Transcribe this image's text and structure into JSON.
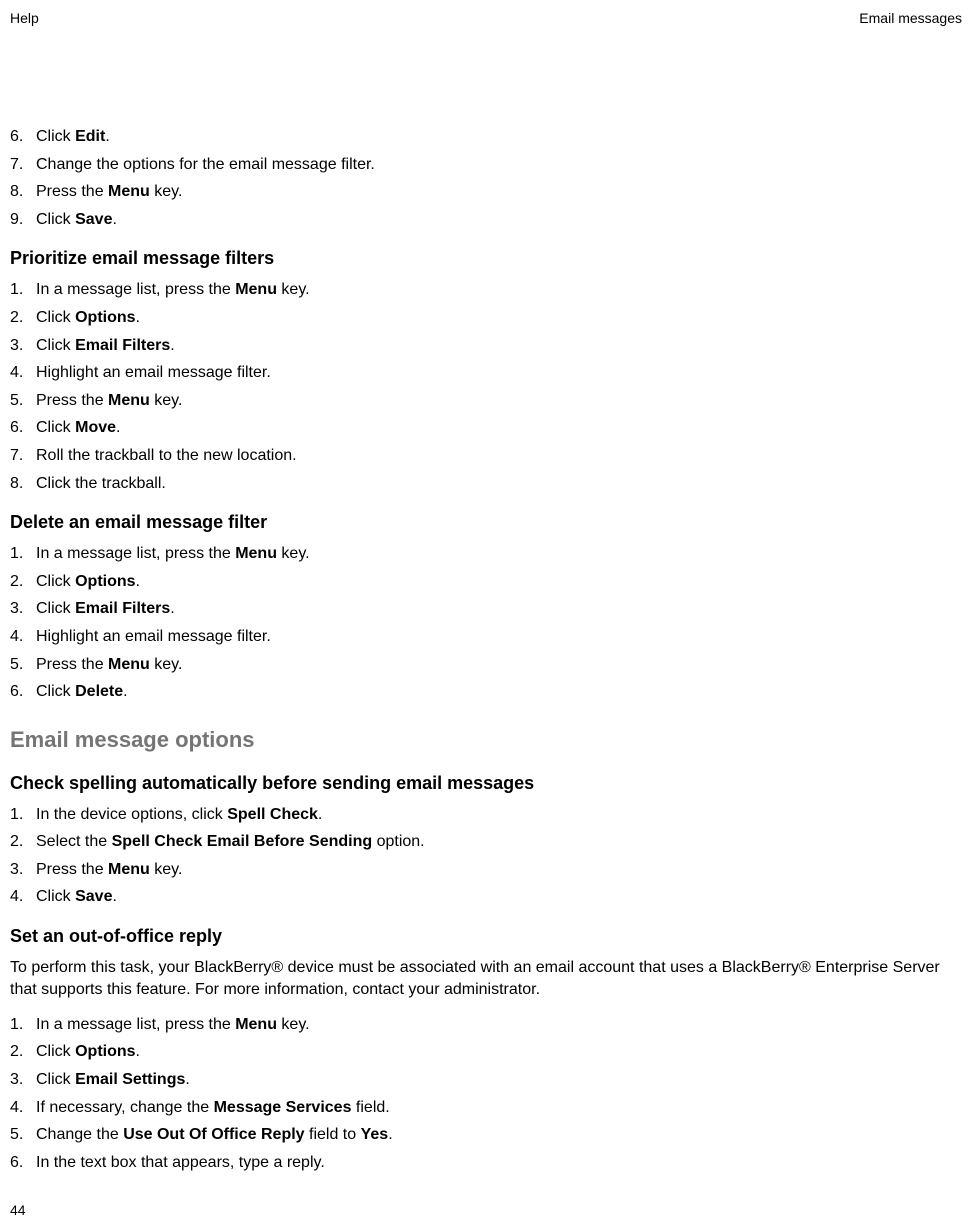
{
  "header": {
    "left": "Help",
    "right": "Email messages"
  },
  "section1": {
    "items": [
      {
        "num": "6.",
        "pre": "Click ",
        "bold": "Edit",
        "post": "."
      },
      {
        "num": "7.",
        "pre": "Change the options for the email message filter.",
        "bold": "",
        "post": ""
      },
      {
        "num": "8.",
        "pre": "Press the ",
        "bold": "Menu",
        "post": " key."
      },
      {
        "num": "9.",
        "pre": "Click ",
        "bold": "Save",
        "post": "."
      }
    ]
  },
  "section2": {
    "title": "Prioritize email message filters",
    "items": [
      {
        "num": "1.",
        "pre": "In a message list, press the ",
        "bold": "Menu",
        "post": " key."
      },
      {
        "num": "2.",
        "pre": "Click ",
        "bold": "Options",
        "post": "."
      },
      {
        "num": "3.",
        "pre": "Click ",
        "bold": "Email Filters",
        "post": "."
      },
      {
        "num": "4.",
        "pre": "Highlight an email message filter.",
        "bold": "",
        "post": ""
      },
      {
        "num": "5.",
        "pre": "Press the ",
        "bold": "Menu",
        "post": " key."
      },
      {
        "num": "6.",
        "pre": "Click ",
        "bold": "Move",
        "post": "."
      },
      {
        "num": "7.",
        "pre": "Roll the trackball to the new location.",
        "bold": "",
        "post": ""
      },
      {
        "num": "8.",
        "pre": "Click the trackball.",
        "bold": "",
        "post": ""
      }
    ]
  },
  "section3": {
    "title": "Delete an email message filter",
    "items": [
      {
        "num": "1.",
        "pre": "In a message list, press the ",
        "bold": "Menu",
        "post": " key."
      },
      {
        "num": "2.",
        "pre": "Click ",
        "bold": "Options",
        "post": "."
      },
      {
        "num": "3.",
        "pre": "Click ",
        "bold": "Email Filters",
        "post": "."
      },
      {
        "num": "4.",
        "pre": "Highlight an email message filter.",
        "bold": "",
        "post": ""
      },
      {
        "num": "5.",
        "pre": "Press the ",
        "bold": "Menu",
        "post": " key."
      },
      {
        "num": "6.",
        "pre": "Click ",
        "bold": "Delete",
        "post": "."
      }
    ]
  },
  "bigheading": "Email message options",
  "section4": {
    "title": "Check spelling automatically before sending email messages",
    "items": [
      {
        "num": "1.",
        "pre": "In the device options, click ",
        "bold": "Spell Check",
        "post": "."
      },
      {
        "num": "2.",
        "pre": "Select the ",
        "bold": "Spell Check Email Before Sending",
        "post": " option."
      },
      {
        "num": "3.",
        "pre": "Press the ",
        "bold": "Menu",
        "post": " key."
      },
      {
        "num": "4.",
        "pre": "Click ",
        "bold": "Save",
        "post": "."
      }
    ]
  },
  "section5": {
    "title": "Set an out-of-office reply",
    "paragraph": "To perform this task, your BlackBerry® device must be associated with an email account that uses a BlackBerry® Enterprise Server that supports this feature. For more information, contact your administrator.",
    "items": [
      {
        "num": "1.",
        "pre": "In a message list, press the ",
        "bold": "Menu",
        "post": " key."
      },
      {
        "num": "2.",
        "pre": "Click ",
        "bold": "Options",
        "post": "."
      },
      {
        "num": "3.",
        "pre": "Click ",
        "bold": "Email Settings",
        "post": "."
      },
      {
        "num": "4.",
        "pre": "If necessary, change the ",
        "bold": "Message Services",
        "post": " field."
      },
      {
        "num": "5.",
        "pre": "Change the ",
        "bold": "Use Out Of Office Reply",
        "post": " field to ",
        "bold2": "Yes",
        "post2": "."
      },
      {
        "num": "6.",
        "pre": "In the text box that appears, type a reply.",
        "bold": "",
        "post": ""
      }
    ]
  },
  "page_number": "44"
}
